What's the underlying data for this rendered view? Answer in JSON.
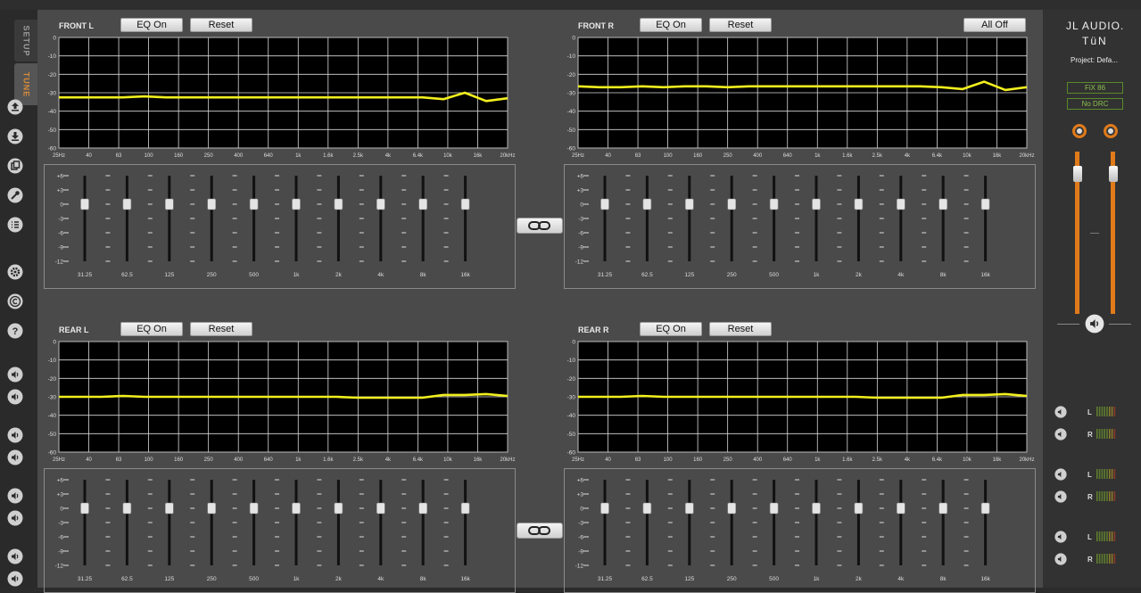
{
  "sidebar": {
    "tabs": [
      {
        "label": "SETUP"
      },
      {
        "label": "TUNE"
      }
    ],
    "icons": [
      "upload-icon",
      "download-icon",
      "copy-icon",
      "wrench-icon",
      "list-icon",
      "gear-icon",
      "copyright-icon",
      "help-icon",
      "speaker-icon"
    ]
  },
  "channels": [
    {
      "key": "fl",
      "title": "FRONT L",
      "eq_label": "EQ On",
      "reset_label": "Reset",
      "curve": [
        -32.5,
        -32.5,
        -32.5,
        -32.5,
        -32,
        -32.5,
        -32.5,
        -32.5,
        -32.5,
        -32.5,
        -32.5,
        -32.5,
        -32.5,
        -32.5,
        -32.5,
        -32.5,
        -32.5,
        -32.5,
        -33.5,
        -30,
        -34.5,
        -33
      ]
    },
    {
      "key": "fr",
      "title": "FRONT R",
      "eq_label": "EQ On",
      "reset_label": "Reset",
      "curve": [
        -26.5,
        -27,
        -27,
        -26.5,
        -27,
        -26.5,
        -26.5,
        -27,
        -26.5,
        -26.5,
        -26.5,
        -26.5,
        -26.5,
        -26.5,
        -26.5,
        -26.5,
        -26.5,
        -27,
        -28,
        -24,
        -28.5,
        -27
      ]
    },
    {
      "key": "rl",
      "title": "REAR L",
      "eq_label": "EQ On",
      "reset_label": "Reset",
      "curve": [
        -30,
        -30,
        -30,
        -29.5,
        -30,
        -30,
        -30,
        -30,
        -30,
        -30,
        -30,
        -30,
        -30,
        -30,
        -30.5,
        -30.5,
        -30.5,
        -30.5,
        -29,
        -29,
        -28.5,
        -29.5
      ]
    },
    {
      "key": "rr",
      "title": "REAR R",
      "eq_label": "EQ On",
      "reset_label": "Reset",
      "curve": [
        -30,
        -30,
        -30,
        -29.5,
        -30,
        -30,
        -30,
        -30,
        -30,
        -30,
        -30,
        -30,
        -30,
        -30,
        -30.5,
        -30.5,
        -30.5,
        -30.5,
        -29,
        -29,
        -28.5,
        -29.5
      ]
    }
  ],
  "all_off_label": "All Off",
  "graph_axis": {
    "y_ticks": [
      "0",
      "-10",
      "-20",
      "-30",
      "-40",
      "-50",
      "-60"
    ],
    "x_ticks": [
      "25Hz",
      "40",
      "63",
      "100",
      "160",
      "250",
      "400",
      "640",
      "1k",
      "1.6k",
      "2.5k",
      "4k",
      "6.4k",
      "10k",
      "16k",
      "20kHz"
    ]
  },
  "eq_axis": {
    "gain_ticks": [
      "+6",
      "+3",
      "0",
      "-3",
      "-6",
      "-9",
      "-12"
    ],
    "bands": [
      "31.25",
      "62.5",
      "125",
      "250",
      "500",
      "1k",
      "2k",
      "4k",
      "8k",
      "16k"
    ],
    "band_gains": [
      0,
      0,
      0,
      0,
      0,
      0,
      0,
      0,
      0,
      0
    ]
  },
  "right_panel": {
    "logo_line1": "JL AUDIO.",
    "logo_line2": "TüN",
    "project": "Project: Defa...",
    "status1": "FiX 86",
    "status2": "No DRC",
    "master_levels": [
      0.9,
      0.9
    ],
    "meter_rows": [
      {
        "label": "L"
      },
      {
        "label": "R"
      },
      {
        "label": "L"
      },
      {
        "label": "R"
      },
      {
        "label": "L"
      },
      {
        "label": "R"
      }
    ]
  },
  "colors": {
    "accent": "#e07a1a",
    "curve": "#f2ef1e",
    "grid": "#d9d9d9",
    "green": "#8cc04a"
  }
}
